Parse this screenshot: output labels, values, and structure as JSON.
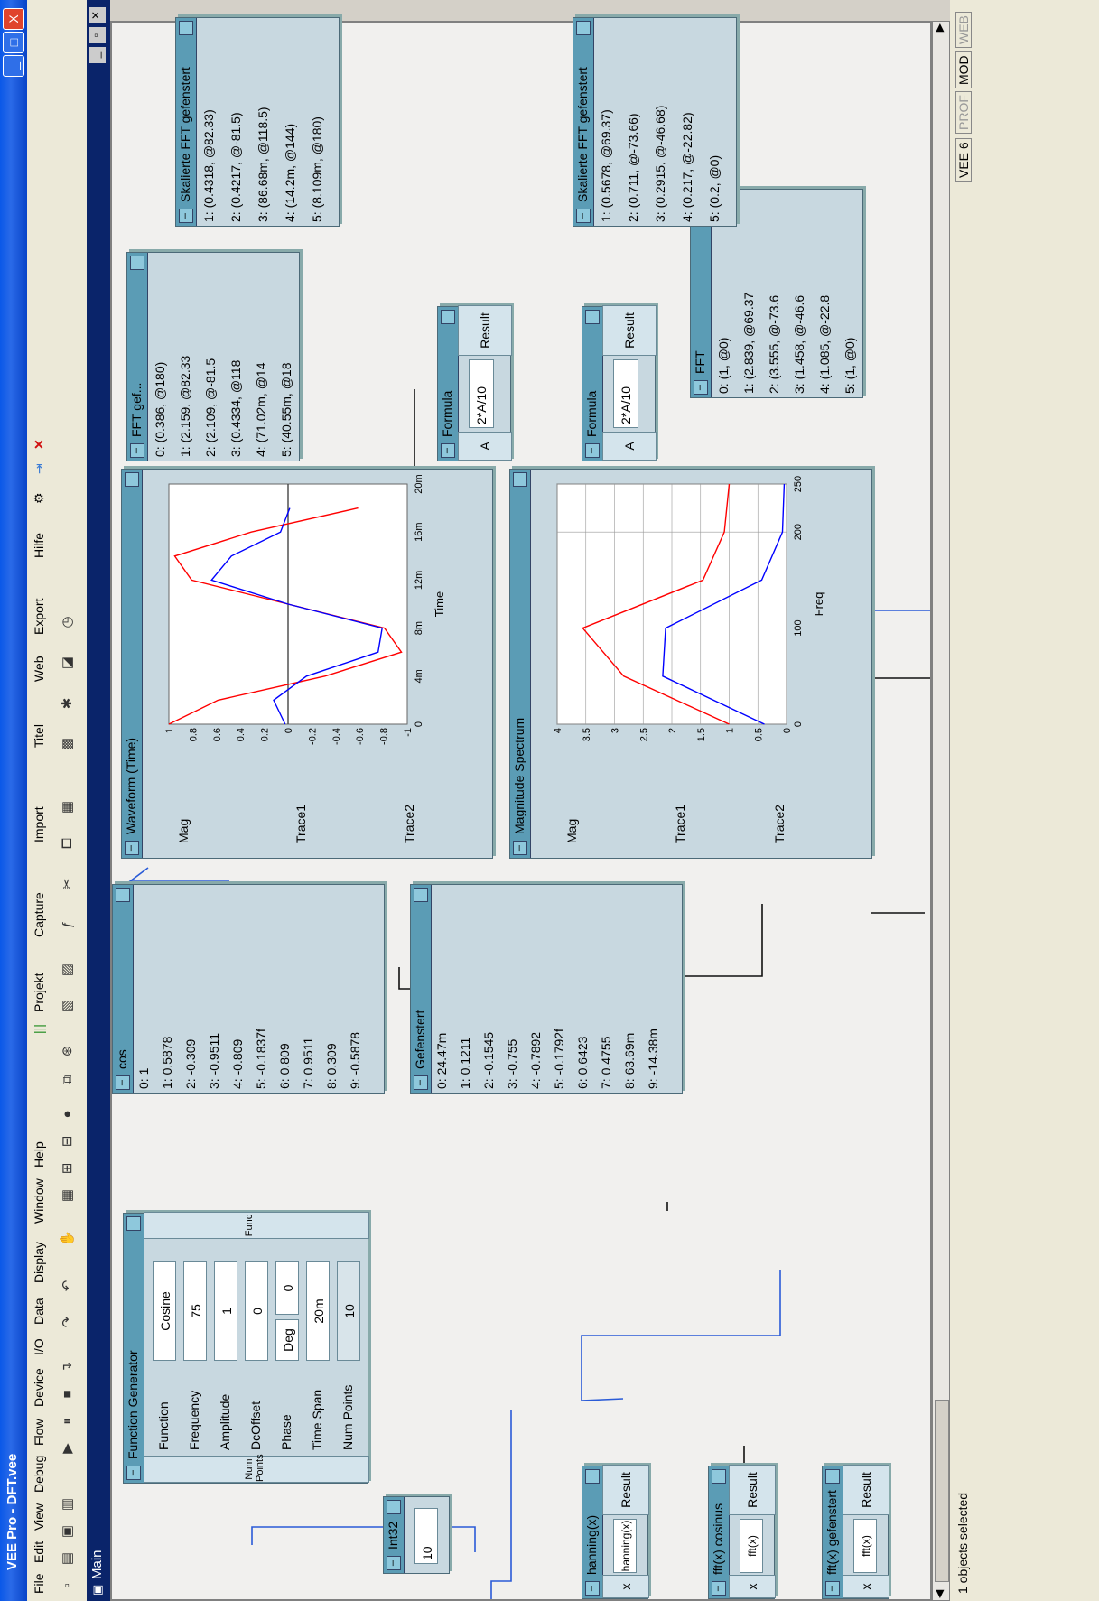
{
  "window": {
    "title": "VEE Pro - DFT.vee",
    "close": "X",
    "restore": "□",
    "minimize": "_"
  },
  "menu": [
    "File",
    "Edit",
    "View",
    "Debug",
    "Flow",
    "Device",
    "I/O",
    "Data",
    "Display",
    "Window",
    "Help"
  ],
  "toolbar_extra": [
    "Projekt",
    "Capture",
    "Import",
    "Titel",
    "Web",
    "Export",
    "Hilfe"
  ],
  "main": {
    "title": "Main"
  },
  "status": {
    "text": "1 objects selected",
    "veever": "VEE 6",
    "prof": "PROF",
    "mod": "MOD",
    "web": "WEB"
  },
  "int32": {
    "title": "Int32",
    "value": "10"
  },
  "funcgen": {
    "title": "Function Generator",
    "output": "Func",
    "input": "Num Points",
    "fields": [
      {
        "label": "Function",
        "value": "Cosine"
      },
      {
        "label": "Frequency",
        "value": "75"
      },
      {
        "label": "Amplitude",
        "value": "1"
      },
      {
        "label": "DcOffset",
        "value": "0"
      },
      {
        "label": "Phase",
        "value": "0",
        "unit": "Deg"
      },
      {
        "label": "Time Span",
        "value": "20m"
      },
      {
        "label": "Num Points",
        "value": "10"
      }
    ]
  },
  "hanning": {
    "title": "hanning(x)",
    "expr": "hanning(x)",
    "in": "x",
    "out": "Result"
  },
  "fftcos": {
    "title": "fft(x) cosinus",
    "expr": "fft(x)",
    "in": "x",
    "out": "Result"
  },
  "fftgef": {
    "title": "fft(x) gefenstert",
    "expr": "fft(x)",
    "in": "x",
    "out": "Result"
  },
  "cos": {
    "title": "cos",
    "rows": [
      "0: 1",
      "1: 0.5878",
      "2: -0.309",
      "3: -0.9511",
      "4: -0.809",
      "5: -0.1837f",
      "6: 0.809",
      "7: 0.9511",
      "8: 0.309",
      "9: -0.5878"
    ]
  },
  "gef": {
    "title": "Gefenstert",
    "rows": [
      "0: 24.47m",
      "1: 0.1211",
      "2: -0.1545",
      "3: -0.755",
      "4: -0.7892",
      "5: -0.1792f",
      "6: 0.6423",
      "7: 0.4755",
      "8: 63.69m",
      "9: -14.38m"
    ]
  },
  "waveform": {
    "title": "Waveform (Time)",
    "ylabel": "Mag",
    "xlabel": "Time",
    "trace1": "Trace1",
    "trace2": "Trace2"
  },
  "spectrum": {
    "title": "Magnitude Spectrum",
    "ylabel": "Mag",
    "xlabel": "Freq",
    "trace1": "Trace1",
    "trace2": "Trace2"
  },
  "fftgefbox": {
    "title": "FFT gef...",
    "rows": [
      "0: (0.386, @180)",
      "1: (2.159, @82.33",
      "2: (2.109, @-81.5",
      "3: (0.4334, @118",
      "4: (71.02m, @14",
      "5: (40.55m, @18"
    ]
  },
  "formula1": {
    "title": "Formula",
    "expr": "2*A/10",
    "in": "A",
    "out": "Result"
  },
  "formula2": {
    "title": "Formula",
    "expr": "2*A/10",
    "in": "A",
    "out": "Result"
  },
  "skal1": {
    "title": "Skalierte FFT gefenstert",
    "rows": [
      "1: (0.4318, @82.33)",
      "2: (0.4217, @-81.5)",
      "3: (86.68m, @118.5)",
      "4: (14.2m, @144)",
      "5: (8.109m, @180)"
    ]
  },
  "skal2": {
    "title": "Skalierte FFT gefenstert",
    "rows": [
      "1: (0.5678, @69.37)",
      "2: (0.711, @-73.66)",
      "3: (0.2915, @-46.68)",
      "4: (0.217, @-22.82)",
      "5: (0.2, @0)"
    ]
  },
  "fftbox": {
    "title": "FFT",
    "rows": [
      "0: (1, @0)",
      "1: (2.839, @69.37",
      "2: (3.555, @-73.6",
      "3: (1.458, @-46.6",
      "4: (1.085, @-22.8",
      "5: (1, @0)"
    ]
  },
  "chart_data": [
    {
      "type": "line",
      "title": "Waveform (Time)",
      "xlabel": "Time",
      "ylabel": "Mag",
      "xticks": [
        "0",
        "4m",
        "8m",
        "12m",
        "16m",
        "20m"
      ],
      "yticks": [
        "1",
        "0.8",
        "0.6",
        "0.4",
        "0.2",
        "0",
        "-0.2",
        "-0.4",
        "-0.6",
        "-0.8",
        "-1"
      ],
      "xlim": [
        0,
        0.02
      ],
      "ylim": [
        -1,
        1
      ],
      "series": [
        {
          "name": "Trace1",
          "color": "#ff0000",
          "x": [
            0,
            0.002,
            0.004,
            0.006,
            0.008,
            0.01,
            0.012,
            0.014,
            0.016,
            0.018
          ],
          "y": [
            1,
            0.5878,
            -0.309,
            -0.9511,
            -0.809,
            0,
            0.809,
            0.9511,
            0.309,
            -0.5878
          ]
        },
        {
          "name": "Trace2",
          "color": "#0000ff",
          "x": [
            0,
            0.002,
            0.004,
            0.006,
            0.008,
            0.01,
            0.012,
            0.014,
            0.016,
            0.018
          ],
          "y": [
            0.02447,
            0.1211,
            -0.1545,
            -0.755,
            -0.7892,
            0,
            0.6423,
            0.4755,
            0.06369,
            -0.01438
          ]
        }
      ]
    },
    {
      "type": "line",
      "title": "Magnitude Spectrum",
      "xlabel": "Freq",
      "ylabel": "Mag",
      "xticks": [
        "0",
        "100",
        "200",
        "250"
      ],
      "yticks": [
        "4",
        "3.5",
        "3",
        "2.5",
        "2",
        "1.5",
        "1",
        "0.5",
        "0"
      ],
      "xlim": [
        0,
        250
      ],
      "ylim": [
        0,
        4
      ],
      "series": [
        {
          "name": "Trace1",
          "color": "#ff0000",
          "x": [
            0,
            50,
            100,
            150,
            200,
            250
          ],
          "y": [
            1,
            2.839,
            3.555,
            1.458,
            1.085,
            1
          ]
        },
        {
          "name": "Trace2",
          "color": "#0000ff",
          "x": [
            0,
            50,
            100,
            150,
            200,
            250
          ],
          "y": [
            0.386,
            2.159,
            2.109,
            0.4334,
            0.07102,
            0.04055
          ]
        }
      ]
    }
  ]
}
